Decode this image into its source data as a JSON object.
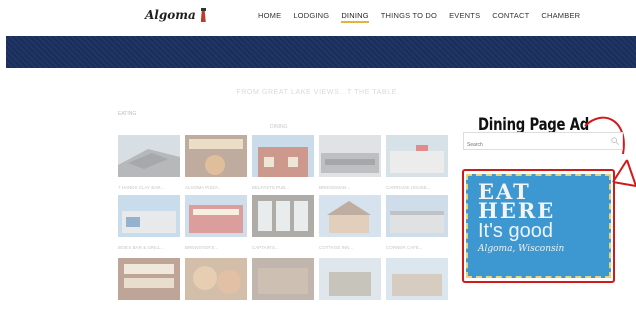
{
  "site": {
    "logo_text": "Algoma"
  },
  "nav": {
    "items": [
      {
        "label": "HOME"
      },
      {
        "label": "LODGING"
      },
      {
        "label": "DINING",
        "active": true
      },
      {
        "label": "THINGS TO DO"
      },
      {
        "label": "EVENTS"
      },
      {
        "label": "CONTACT"
      },
      {
        "label": "CHAMBER"
      }
    ]
  },
  "tagline": "FROM GREAT LAKE VIEWS...T THE TABLE.",
  "section_small": "EATING",
  "grid_heading": "DINING",
  "grid": {
    "tiles": [
      {
        "caption": "7 HANDS CLAY BAR..."
      },
      {
        "caption": "ALGOMA PIZZA..."
      },
      {
        "caption": "BELFASTS PUB..."
      },
      {
        "caption": "BRIDGEMAN..."
      },
      {
        "caption": "CARRIAGE HOUSE..."
      },
      {
        "caption": "BOB'S BAR & GRILL..."
      },
      {
        "caption": "BREWSTER'S..."
      },
      {
        "caption": "CAPTAIN'S..."
      },
      {
        "caption": "COTTAGE INN..."
      },
      {
        "caption": "CORNER CAFE..."
      },
      {
        "caption": ""
      },
      {
        "caption": ""
      },
      {
        "caption": ""
      },
      {
        "caption": ""
      },
      {
        "caption": ""
      }
    ]
  },
  "sidebar": {
    "search_placeholder": "Search",
    "ad_label": "Dining Page Ad",
    "ad": {
      "line1": "EAT",
      "line2": "HERE",
      "line3": "It's good",
      "line4": "Algoma, Wisconsin"
    }
  },
  "colors": {
    "banner": "#1b2f5e",
    "nav_active_underline": "#e2b43b",
    "annotation_red": "#d11a1a",
    "ad_background": "#3d97d0"
  }
}
